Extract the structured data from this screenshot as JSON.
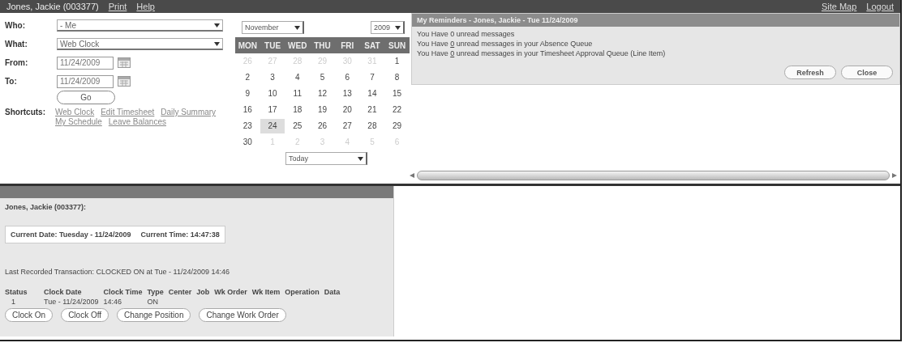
{
  "header": {
    "user": "Jones, Jackie (003377)",
    "links": [
      "Print",
      "Help"
    ],
    "right_links": [
      "Site Map",
      "Logout"
    ]
  },
  "form": {
    "fields": [
      {
        "label": "Who:",
        "kind": "select",
        "value": "- Me"
      },
      {
        "label": "What:",
        "kind": "select",
        "value": "Web Clock"
      },
      {
        "label": "From:",
        "kind": "date",
        "value": "11/24/2009"
      },
      {
        "label": "To:",
        "kind": "date",
        "value": "11/24/2009"
      }
    ],
    "go_button": "Go",
    "shortcuts_label": "Shortcuts:",
    "shortcuts": [
      "Web Clock",
      "Edit Timesheet",
      "Daily Summary",
      "My Schedule",
      "Leave Balances"
    ]
  },
  "calendar": {
    "month": "November",
    "year": "2009",
    "weekdays": [
      "MON",
      "TUE",
      "WED",
      "THU",
      "FRI",
      "SAT",
      "SUN"
    ],
    "weeks": [
      [
        {
          "day": "26",
          "other": true,
          "selected": false
        },
        {
          "day": "27",
          "other": true,
          "selected": false
        },
        {
          "day": "28",
          "other": true,
          "selected": false
        },
        {
          "day": "29",
          "other": true,
          "selected": false
        },
        {
          "day": "30",
          "other": true,
          "selected": false
        },
        {
          "day": "31",
          "other": true,
          "selected": false
        },
        {
          "day": "1",
          "other": false,
          "selected": false
        }
      ],
      [
        {
          "day": "2",
          "other": false,
          "selected": false
        },
        {
          "day": "3",
          "other": false,
          "selected": false
        },
        {
          "day": "4",
          "other": false,
          "selected": false
        },
        {
          "day": "5",
          "other": false,
          "selected": false
        },
        {
          "day": "6",
          "other": false,
          "selected": false
        },
        {
          "day": "7",
          "other": false,
          "selected": false
        },
        {
          "day": "8",
          "other": false,
          "selected": false
        }
      ],
      [
        {
          "day": "9",
          "other": false,
          "selected": false
        },
        {
          "day": "10",
          "other": false,
          "selected": false
        },
        {
          "day": "11",
          "other": false,
          "selected": false
        },
        {
          "day": "12",
          "other": false,
          "selected": false
        },
        {
          "day": "13",
          "other": false,
          "selected": false
        },
        {
          "day": "14",
          "other": false,
          "selected": false
        },
        {
          "day": "15",
          "other": false,
          "selected": false
        }
      ],
      [
        {
          "day": "16",
          "other": false,
          "selected": false
        },
        {
          "day": "17",
          "other": false,
          "selected": false
        },
        {
          "day": "18",
          "other": false,
          "selected": false
        },
        {
          "day": "19",
          "other": false,
          "selected": false
        },
        {
          "day": "20",
          "other": false,
          "selected": false
        },
        {
          "day": "21",
          "other": false,
          "selected": false
        },
        {
          "day": "22",
          "other": false,
          "selected": false
        }
      ],
      [
        {
          "day": "23",
          "other": false,
          "selected": false
        },
        {
          "day": "24",
          "other": false,
          "selected": true
        },
        {
          "day": "25",
          "other": false,
          "selected": false
        },
        {
          "day": "26",
          "other": false,
          "selected": false
        },
        {
          "day": "27",
          "other": false,
          "selected": false
        },
        {
          "day": "28",
          "other": false,
          "selected": false
        },
        {
          "day": "29",
          "other": false,
          "selected": false
        }
      ],
      [
        {
          "day": "30",
          "other": false,
          "selected": false
        },
        {
          "day": "1",
          "other": true,
          "selected": false
        },
        {
          "day": "2",
          "other": true,
          "selected": false
        },
        {
          "day": "3",
          "other": true,
          "selected": false
        },
        {
          "day": "4",
          "other": true,
          "selected": false
        },
        {
          "day": "5",
          "other": true,
          "selected": false
        },
        {
          "day": "6",
          "other": true,
          "selected": false
        }
      ]
    ],
    "today_select": "Today"
  },
  "reminders": {
    "title": "My Reminders - Jones, Jackie - Tue 11/24/2009",
    "messages": [
      {
        "prefix": "You Have",
        "count": "0",
        "suffix": "unread messages",
        "link": false
      },
      {
        "prefix": "You Have",
        "count": "0",
        "suffix": "unread messages in your Absence Queue",
        "link": true
      },
      {
        "prefix": "You Have",
        "count": "0",
        "suffix": "unread messages in your Timesheet Approval Queue (Line Item)",
        "link": true
      }
    ],
    "buttons": [
      "Refresh",
      "Close"
    ]
  },
  "clock": {
    "name": "Jones, Jackie (003377):",
    "current_date": "Current Date: Tuesday - 11/24/2009",
    "current_time": "Current Time: 14:47:38",
    "last_transaction": "Last Recorded Transaction: CLOCKED ON at Tue - 11/24/2009 14:46",
    "columns": [
      "Status",
      "Clock Date",
      "Clock Time",
      "Type",
      "Center",
      "Job",
      "Wk Order",
      "Wk Item",
      "Operation",
      "Data"
    ],
    "rows": [
      [
        "1",
        "Tue - 11/24/2009",
        "14:46",
        "ON"
      ]
    ],
    "buttons": [
      "Clock On",
      "Clock Off",
      "Change Position",
      "Change Work Order"
    ]
  }
}
